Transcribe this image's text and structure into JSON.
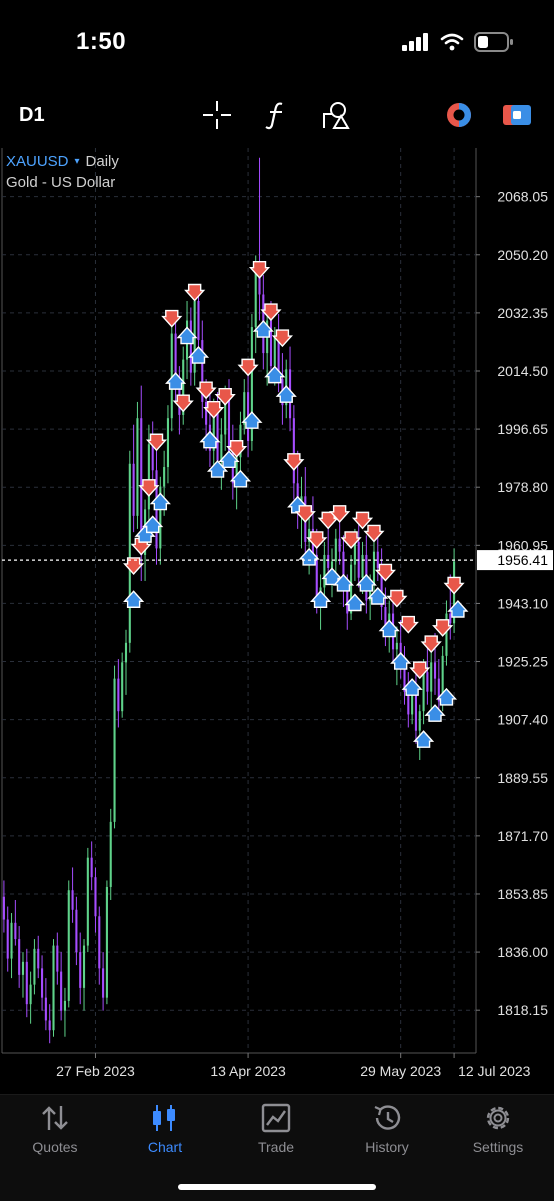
{
  "status": {
    "time": "1:50",
    "icons": [
      "cellular-signal-icon",
      "wifi-icon",
      "battery-icon"
    ]
  },
  "toolbar": {
    "timeframe": "D1",
    "icons": [
      "crosshair-icon",
      "indicators-icon",
      "objects-icon",
      "color-theme-icon",
      "trade-toggle-icon"
    ]
  },
  "symbol": {
    "name": "XAUUSD",
    "arrow": "▾",
    "timeframe": "Daily",
    "description": "Gold - US Dollar"
  },
  "chart_data": {
    "type": "candlestick",
    "y_ticks": [
      "2068.05",
      "2050.20",
      "2032.35",
      "2014.50",
      "1996.65",
      "1978.80",
      "1960.95",
      "1943.10",
      "1925.25",
      "1907.40",
      "1889.55",
      "1871.70",
      "1853.85",
      "1836.00",
      "1818.15"
    ],
    "ylim": [
      1805,
      2083
    ],
    "current_price": "1956.41",
    "x_labels": [
      "27 Feb 2023",
      "13 Apr 2023",
      "29 May 2023",
      "12 Jul 2023"
    ],
    "grid": true,
    "colors": {
      "bull": "#5fd38a",
      "bear": "#a64dff",
      "sell": "#e8574a",
      "buy": "#3a8ee6",
      "price_line": "#ffffff",
      "grid": "#2a2f3a"
    },
    "candles": [
      [
        1853,
        1858,
        1842,
        1846
      ],
      [
        1846,
        1850,
        1830,
        1834
      ],
      [
        1834,
        1848,
        1828,
        1845
      ],
      [
        1845,
        1852,
        1838,
        1840
      ],
      [
        1840,
        1844,
        1825,
        1829
      ],
      [
        1829,
        1836,
        1822,
        1833
      ],
      [
        1833,
        1837,
        1816,
        1820
      ],
      [
        1820,
        1830,
        1814,
        1826
      ],
      [
        1826,
        1840,
        1823,
        1837
      ],
      [
        1837,
        1841,
        1828,
        1831
      ],
      [
        1831,
        1835,
        1818,
        1822
      ],
      [
        1822,
        1828,
        1812,
        1815
      ],
      [
        1815,
        1820,
        1808,
        1812
      ],
      [
        1812,
        1840,
        1810,
        1838
      ],
      [
        1838,
        1842,
        1826,
        1830
      ],
      [
        1830,
        1836,
        1815,
        1818
      ],
      [
        1818,
        1825,
        1810,
        1821
      ],
      [
        1821,
        1858,
        1819,
        1855
      ],
      [
        1855,
        1862,
        1845,
        1849
      ],
      [
        1849,
        1853,
        1832,
        1836
      ],
      [
        1836,
        1842,
        1820,
        1825
      ],
      [
        1825,
        1840,
        1818,
        1838
      ],
      [
        1838,
        1868,
        1836,
        1865
      ],
      [
        1865,
        1870,
        1855,
        1859
      ],
      [
        1859,
        1862,
        1842,
        1847
      ],
      [
        1847,
        1850,
        1826,
        1831
      ],
      [
        1831,
        1836,
        1818,
        1822
      ],
      [
        1822,
        1858,
        1820,
        1856
      ],
      [
        1856,
        1880,
        1852,
        1876
      ],
      [
        1876,
        1924,
        1874,
        1920
      ],
      [
        1920,
        1926,
        1905,
        1910
      ],
      [
        1910,
        1928,
        1908,
        1925
      ],
      [
        1925,
        1935,
        1915,
        1931
      ],
      [
        1931,
        1990,
        1928,
        1986
      ],
      [
        1986,
        1998,
        1965,
        1970
      ],
      [
        1970,
        2005,
        1966,
        2000
      ],
      [
        2000,
        2010,
        1950,
        1958
      ],
      [
        1958,
        1975,
        1950,
        1972
      ],
      [
        1972,
        1998,
        1968,
        1992
      ],
      [
        1992,
        1999,
        1980,
        1984
      ],
      [
        1984,
        1990,
        1955,
        1960
      ],
      [
        1960,
        1982,
        1955,
        1979
      ],
      [
        1979,
        1990,
        1970,
        1985
      ],
      [
        1985,
        2004,
        1980,
        2000
      ],
      [
        2000,
        2030,
        1996,
        2026
      ],
      [
        2026,
        2032,
        2005,
        2010
      ],
      [
        2010,
        2016,
        1995,
        2001
      ],
      [
        2001,
        2022,
        1998,
        2018
      ],
      [
        2018,
        2036,
        2012,
        2030
      ],
      [
        2030,
        2034,
        2010,
        2014
      ],
      [
        2014,
        2040,
        2010,
        2036
      ],
      [
        2036,
        2041,
        2020,
        2024
      ],
      [
        2024,
        2030,
        2000,
        2005
      ],
      [
        2005,
        2012,
        1990,
        1998
      ],
      [
        1998,
        2008,
        1985,
        1990
      ],
      [
        1990,
        2006,
        1984,
        2002
      ],
      [
        2002,
        2008,
        1982,
        1987
      ],
      [
        1987,
        2000,
        1978,
        1995
      ],
      [
        1995,
        2010,
        1990,
        2006
      ],
      [
        2006,
        2012,
        1985,
        1990
      ],
      [
        1990,
        1998,
        1975,
        1980
      ],
      [
        1980,
        1992,
        1972,
        1988
      ],
      [
        1988,
        2002,
        1984,
        1998
      ],
      [
        1998,
        2012,
        1995,
        2008
      ],
      [
        2008,
        2014,
        1988,
        1993
      ],
      [
        1993,
        2032,
        1990,
        2028
      ],
      [
        2028,
        2050,
        2020,
        2046
      ],
      [
        2046,
        2080,
        2030,
        2038
      ],
      [
        2038,
        2044,
        2015,
        2020
      ],
      [
        2020,
        2034,
        2010,
        2030
      ],
      [
        2030,
        2036,
        2012,
        2016
      ],
      [
        2016,
        2028,
        2010,
        2025
      ],
      [
        2025,
        2032,
        2008,
        2012
      ],
      [
        2012,
        2020,
        1998,
        2004
      ],
      [
        2004,
        2018,
        2000,
        2015
      ],
      [
        2015,
        2022,
        1996,
        2000
      ],
      [
        2000,
        2004,
        1975,
        1980
      ],
      [
        1980,
        1990,
        1966,
        1972
      ],
      [
        1972,
        1982,
        1960,
        1976
      ],
      [
        1976,
        1985,
        1958,
        1962
      ],
      [
        1962,
        1970,
        1952,
        1966
      ],
      [
        1966,
        1976,
        1955,
        1958
      ],
      [
        1958,
        1966,
        1940,
        1945
      ],
      [
        1945,
        1952,
        1935,
        1948
      ],
      [
        1948,
        1962,
        1944,
        1958
      ],
      [
        1958,
        1970,
        1950,
        1954
      ],
      [
        1954,
        1960,
        1945,
        1956
      ],
      [
        1956,
        1966,
        1952,
        1963
      ],
      [
        1963,
        1972,
        1955,
        1959
      ],
      [
        1959,
        1964,
        1942,
        1947
      ],
      [
        1947,
        1952,
        1935,
        1940
      ],
      [
        1940,
        1958,
        1938,
        1955
      ],
      [
        1955,
        1966,
        1950,
        1962
      ],
      [
        1962,
        1968,
        1948,
        1951
      ],
      [
        1951,
        1962,
        1946,
        1958
      ],
      [
        1958,
        1964,
        1940,
        1944
      ],
      [
        1944,
        1952,
        1938,
        1949
      ],
      [
        1949,
        1962,
        1945,
        1959
      ],
      [
        1959,
        1966,
        1950,
        1954
      ],
      [
        1954,
        1960,
        1938,
        1942
      ],
      [
        1942,
        1948,
        1930,
        1934
      ],
      [
        1934,
        1944,
        1928,
        1940
      ],
      [
        1940,
        1946,
        1925,
        1929
      ],
      [
        1929,
        1936,
        1918,
        1931
      ],
      [
        1931,
        1938,
        1920,
        1924
      ],
      [
        1924,
        1930,
        1912,
        1916
      ],
      [
        1916,
        1922,
        1905,
        1909
      ],
      [
        1909,
        1920,
        1906,
        1917
      ],
      [
        1917,
        1922,
        1900,
        1904
      ],
      [
        1904,
        1912,
        1895,
        1910
      ],
      [
        1910,
        1926,
        1906,
        1922
      ],
      [
        1922,
        1930,
        1912,
        1916
      ],
      [
        1916,
        1928,
        1910,
        1925
      ],
      [
        1925,
        1934,
        1915,
        1920
      ],
      [
        1920,
        1926,
        1908,
        1913
      ],
      [
        1913,
        1930,
        1910,
        1927
      ],
      [
        1927,
        1944,
        1924,
        1940
      ],
      [
        1940,
        1952,
        1932,
        1937
      ],
      [
        1937,
        1960,
        1934,
        1956
      ]
    ],
    "signals": [
      [
        34,
        1954,
        "sell"
      ],
      [
        34,
        1945,
        "buy"
      ],
      [
        36,
        1960,
        "sell"
      ],
      [
        37,
        1965,
        "buy"
      ],
      [
        38,
        1978,
        "sell"
      ],
      [
        39,
        1968,
        "buy"
      ],
      [
        40,
        1992,
        "sell"
      ],
      [
        41,
        1975,
        "buy"
      ],
      [
        44,
        2030,
        "sell"
      ],
      [
        45,
        2012,
        "buy"
      ],
      [
        47,
        2004,
        "sell"
      ],
      [
        48,
        2026,
        "buy"
      ],
      [
        50,
        2038,
        "sell"
      ],
      [
        51,
        2020,
        "buy"
      ],
      [
        53,
        2008,
        "sell"
      ],
      [
        54,
        1994,
        "buy"
      ],
      [
        55,
        2002,
        "sell"
      ],
      [
        56,
        1985,
        "buy"
      ],
      [
        58,
        2006,
        "sell"
      ],
      [
        59,
        1988,
        "buy"
      ],
      [
        61,
        1990,
        "sell"
      ],
      [
        62,
        1982,
        "buy"
      ],
      [
        64,
        2015,
        "sell"
      ],
      [
        65,
        2000,
        "buy"
      ],
      [
        67,
        2045,
        "sell"
      ],
      [
        68,
        2028,
        "buy"
      ],
      [
        70,
        2032,
        "sell"
      ],
      [
        71,
        2014,
        "buy"
      ],
      [
        73,
        2024,
        "sell"
      ],
      [
        74,
        2008,
        "buy"
      ],
      [
        76,
        1986,
        "sell"
      ],
      [
        77,
        1974,
        "buy"
      ],
      [
        79,
        1970,
        "sell"
      ],
      [
        80,
        1958,
        "buy"
      ],
      [
        82,
        1962,
        "sell"
      ],
      [
        83,
        1945,
        "buy"
      ],
      [
        85,
        1968,
        "sell"
      ],
      [
        86,
        1952,
        "buy"
      ],
      [
        88,
        1970,
        "sell"
      ],
      [
        89,
        1950,
        "buy"
      ],
      [
        91,
        1962,
        "sell"
      ],
      [
        92,
        1944,
        "buy"
      ],
      [
        94,
        1968,
        "sell"
      ],
      [
        95,
        1950,
        "buy"
      ],
      [
        97,
        1964,
        "sell"
      ],
      [
        98,
        1946,
        "buy"
      ],
      [
        100,
        1952,
        "sell"
      ],
      [
        101,
        1936,
        "buy"
      ],
      [
        103,
        1944,
        "sell"
      ],
      [
        104,
        1926,
        "buy"
      ],
      [
        106,
        1936,
        "sell"
      ],
      [
        107,
        1918,
        "buy"
      ],
      [
        109,
        1922,
        "sell"
      ],
      [
        110,
        1902,
        "buy"
      ],
      [
        112,
        1930,
        "sell"
      ],
      [
        113,
        1910,
        "buy"
      ],
      [
        115,
        1935,
        "sell"
      ],
      [
        116,
        1915,
        "buy"
      ],
      [
        118,
        1948,
        "sell"
      ],
      [
        119,
        1942,
        "buy"
      ]
    ]
  },
  "tabs": [
    {
      "label": "Quotes",
      "icon": "quotes-arrows-icon",
      "active": false
    },
    {
      "label": "Chart",
      "icon": "chart-candles-icon",
      "active": true
    },
    {
      "label": "Trade",
      "icon": "trade-chart-icon",
      "active": false
    },
    {
      "label": "History",
      "icon": "history-clock-icon",
      "active": false
    },
    {
      "label": "Settings",
      "icon": "settings-gear-icon",
      "active": false
    }
  ]
}
